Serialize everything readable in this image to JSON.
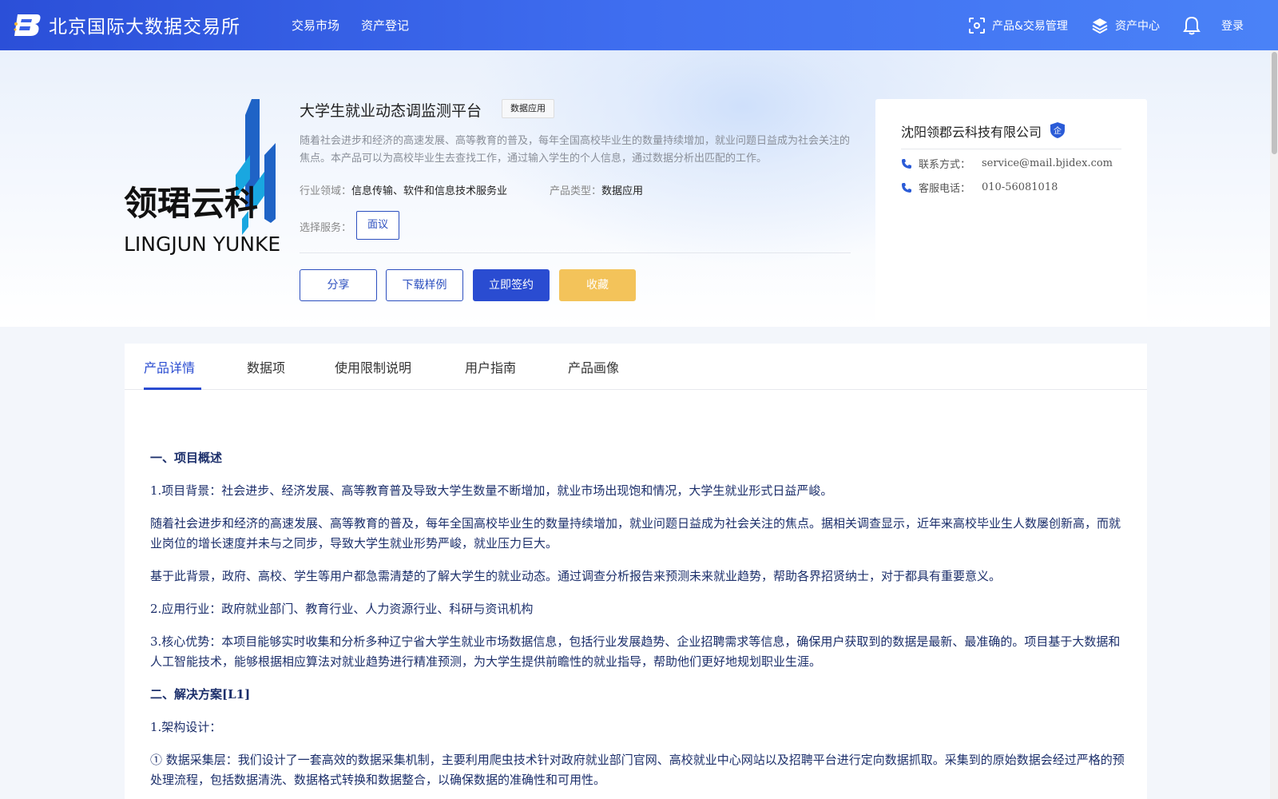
{
  "header": {
    "brand": "北京国际大数据交易所",
    "nav": [
      "交易市场",
      "资产登记"
    ],
    "product_mgmt": "产品&交易管理",
    "asset_center": "资产中心",
    "login": "登录"
  },
  "product": {
    "title": "大学生就业动态调监测平台",
    "tag": "数据应用",
    "description": "随着社会进步和经济的高速发展、高等教育的普及，每年全国高校毕业生的数量持续增加，就业问题日益成为社会关注的焦点。本产品可以为高校毕业生去查找工作，通过输入学生的个人信息，通过数据分析出匹配的工作。",
    "industry_label": "行业领域：",
    "industry_value": "信息传输、软件和信息技术服务业",
    "type_label": "产品类型：",
    "type_value": "数据应用",
    "service_label": "选择服务：",
    "service_option": "面议",
    "buttons": {
      "share": "分享",
      "download": "下载样例",
      "sign": "立即签约",
      "favorite": "收藏"
    }
  },
  "company": {
    "name": "沈阳领郡云科技有限公司",
    "badge": "企",
    "contact_label": "联系方式：",
    "contact_value": "service@mail.bjidex.com",
    "phone_label": "客服电话：",
    "phone_value": "010-56081018"
  },
  "tabs": [
    "产品详情",
    "数据项",
    "使用限制说明",
    "用户指南",
    "产品画像"
  ],
  "content": {
    "h1": "一、项目概述",
    "p1": "1.项目背景：社会进步、经济发展、高等教育普及导致大学生数量不断增加，就业市场出现饱和情况，大学生就业形式日益严峻。",
    "p2": "随着社会进步和经济的高速发展、高等教育的普及，每年全国高校毕业生的数量持续增加，就业问题日益成为社会关注的焦点。据相关调查显示，近年来高校毕业生人数屡创新高，而就业岗位的增长速度并未与之同步，导致大学生就业形势严峻，就业压力巨大。",
    "p3": "基于此背景，政府、高校、学生等用户都急需清楚的了解大学生的就业动态。通过调查分析报告来预测未来就业趋势，帮助各界招贤纳士，对于都具有重要意义。",
    "p4": "2.应用行业：政府就业部门、教育行业、人力资源行业、科研与资讯机构",
    "p5": "3.核心优势：本项目能够实时收集和分析多种辽宁省大学生就业市场数据信息，包括行业发展趋势、企业招聘需求等信息，确保用户获取到的数据是最新、最准确的。项目基于大数据和人工智能技术，能够根据相应算法对就业趋势进行精准预测，为大学生提供前瞻性的就业指导，帮助他们更好地规划职业生涯。",
    "h2": "二、解决方案[L1]",
    "p6": "1.架构设计：",
    "p7": "① 数据采集层：我们设计了一套高效的数据采集机制，主要利用爬虫技术针对政府就业部门官网、高校就业中心网站以及招聘平台进行定向数据抓取。采集到的原始数据会经过严格的预处理流程，包括数据清洗、数据格式转换和数据整合，以确保数据的准确性和可用性。"
  },
  "colors": {
    "primary": "#2a4cd1",
    "gold": "#f3c35a",
    "text_dark_blue": "#1c2f6b"
  }
}
